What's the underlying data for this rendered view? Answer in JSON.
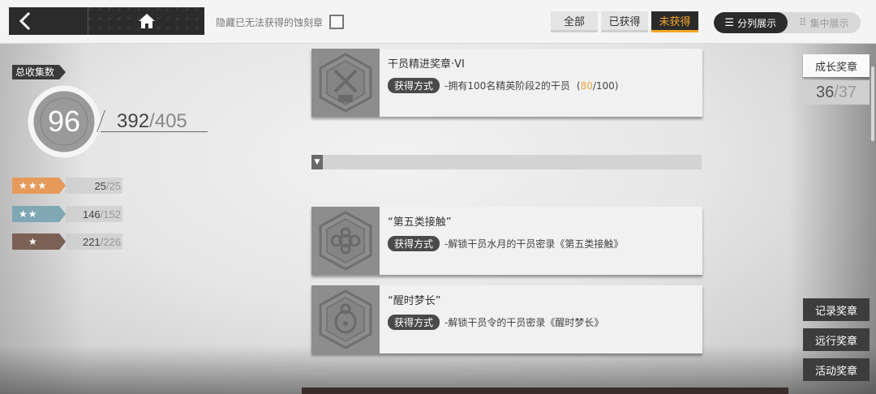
{
  "topbar": {
    "hide_label": "隐藏已无法获得的蚀刻章",
    "filters": [
      "全部",
      "已获得",
      "未获得"
    ],
    "active_filter": "未获得",
    "views": [
      "分列展示",
      "集中展示"
    ]
  },
  "stats": {
    "total_label": "总收集数",
    "percent": "96",
    "count": "392",
    "max": "405",
    "stars": [
      {
        "stars": "★★★",
        "count": "25",
        "max": "25",
        "color": "#e69a5a"
      },
      {
        "stars": "★★",
        "count": "146",
        "max": "152",
        "color": "#7fa7b4"
      },
      {
        "stars": "★",
        "count": "221",
        "max": "226",
        "color": "#7b6155"
      }
    ]
  },
  "medals": [
    {
      "title": "干员精进奖章·VI",
      "method_label": "获得方式",
      "desc": "-拥有100名精英阶段2的干员",
      "progress_cur": "80",
      "progress_max": "/100)",
      "progress_open": "("
    },
    {
      "title": "“第五类接触”",
      "method_label": "获得方式",
      "desc": "-解锁干员水月的干员密录《第五类接触》"
    },
    {
      "title": "“醒时梦长”",
      "method_label": "获得方式",
      "desc": "-解锁干员令的干员密录《醒时梦长》"
    }
  ],
  "side": {
    "growth_label": "成长奖章",
    "growth_count": "36",
    "growth_max": "37",
    "buttons": [
      "记录奖章",
      "远行奖章",
      "活动奖章"
    ]
  },
  "colors": {
    "accent": "#f6a623",
    "progress": "#e8a33c"
  }
}
